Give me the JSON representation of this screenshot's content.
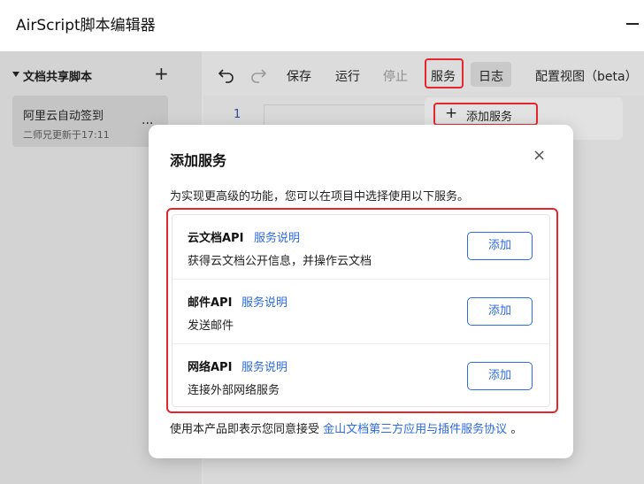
{
  "window": {
    "title": "AirScript脚本编辑器"
  },
  "sidebar": {
    "header": "文档共享脚本",
    "add_symbol": "+",
    "scripts": [
      {
        "name": "阿里云自动签到",
        "meta": "二师兄更新于17:11",
        "more": "..."
      }
    ]
  },
  "toolbar": {
    "undo_icon": "undo-icon",
    "redo_icon": "redo-icon",
    "save": "保存",
    "run": "运行",
    "stop": "停止",
    "services": "服务",
    "log": "日志",
    "config_view": "配置视图（beta）"
  },
  "editor": {
    "line_number": "1"
  },
  "services_menu": {
    "add_service": "添加服务"
  },
  "modal": {
    "title": "添加服务",
    "close_symbol": "×",
    "description": "为实现更高级的功能，您可以在项目中选择使用以下服务。",
    "services": [
      {
        "name": "云文档API",
        "link": "服务说明",
        "desc": "获得云文档公开信息，并操作云文档",
        "button": "添加"
      },
      {
        "name": "邮件API",
        "link": "服务说明",
        "desc": "发送邮件",
        "button": "添加"
      },
      {
        "name": "网络API",
        "link": "服务说明",
        "desc": "连接外部网络服务",
        "button": "添加"
      }
    ],
    "footer_prefix": "使用本产品即表示您同意接受",
    "footer_link": "金山文档第三方应用与插件服务协议",
    "footer_suffix": "。"
  },
  "colors": {
    "accent": "#2c6be0",
    "highlight": "#e5262d"
  }
}
